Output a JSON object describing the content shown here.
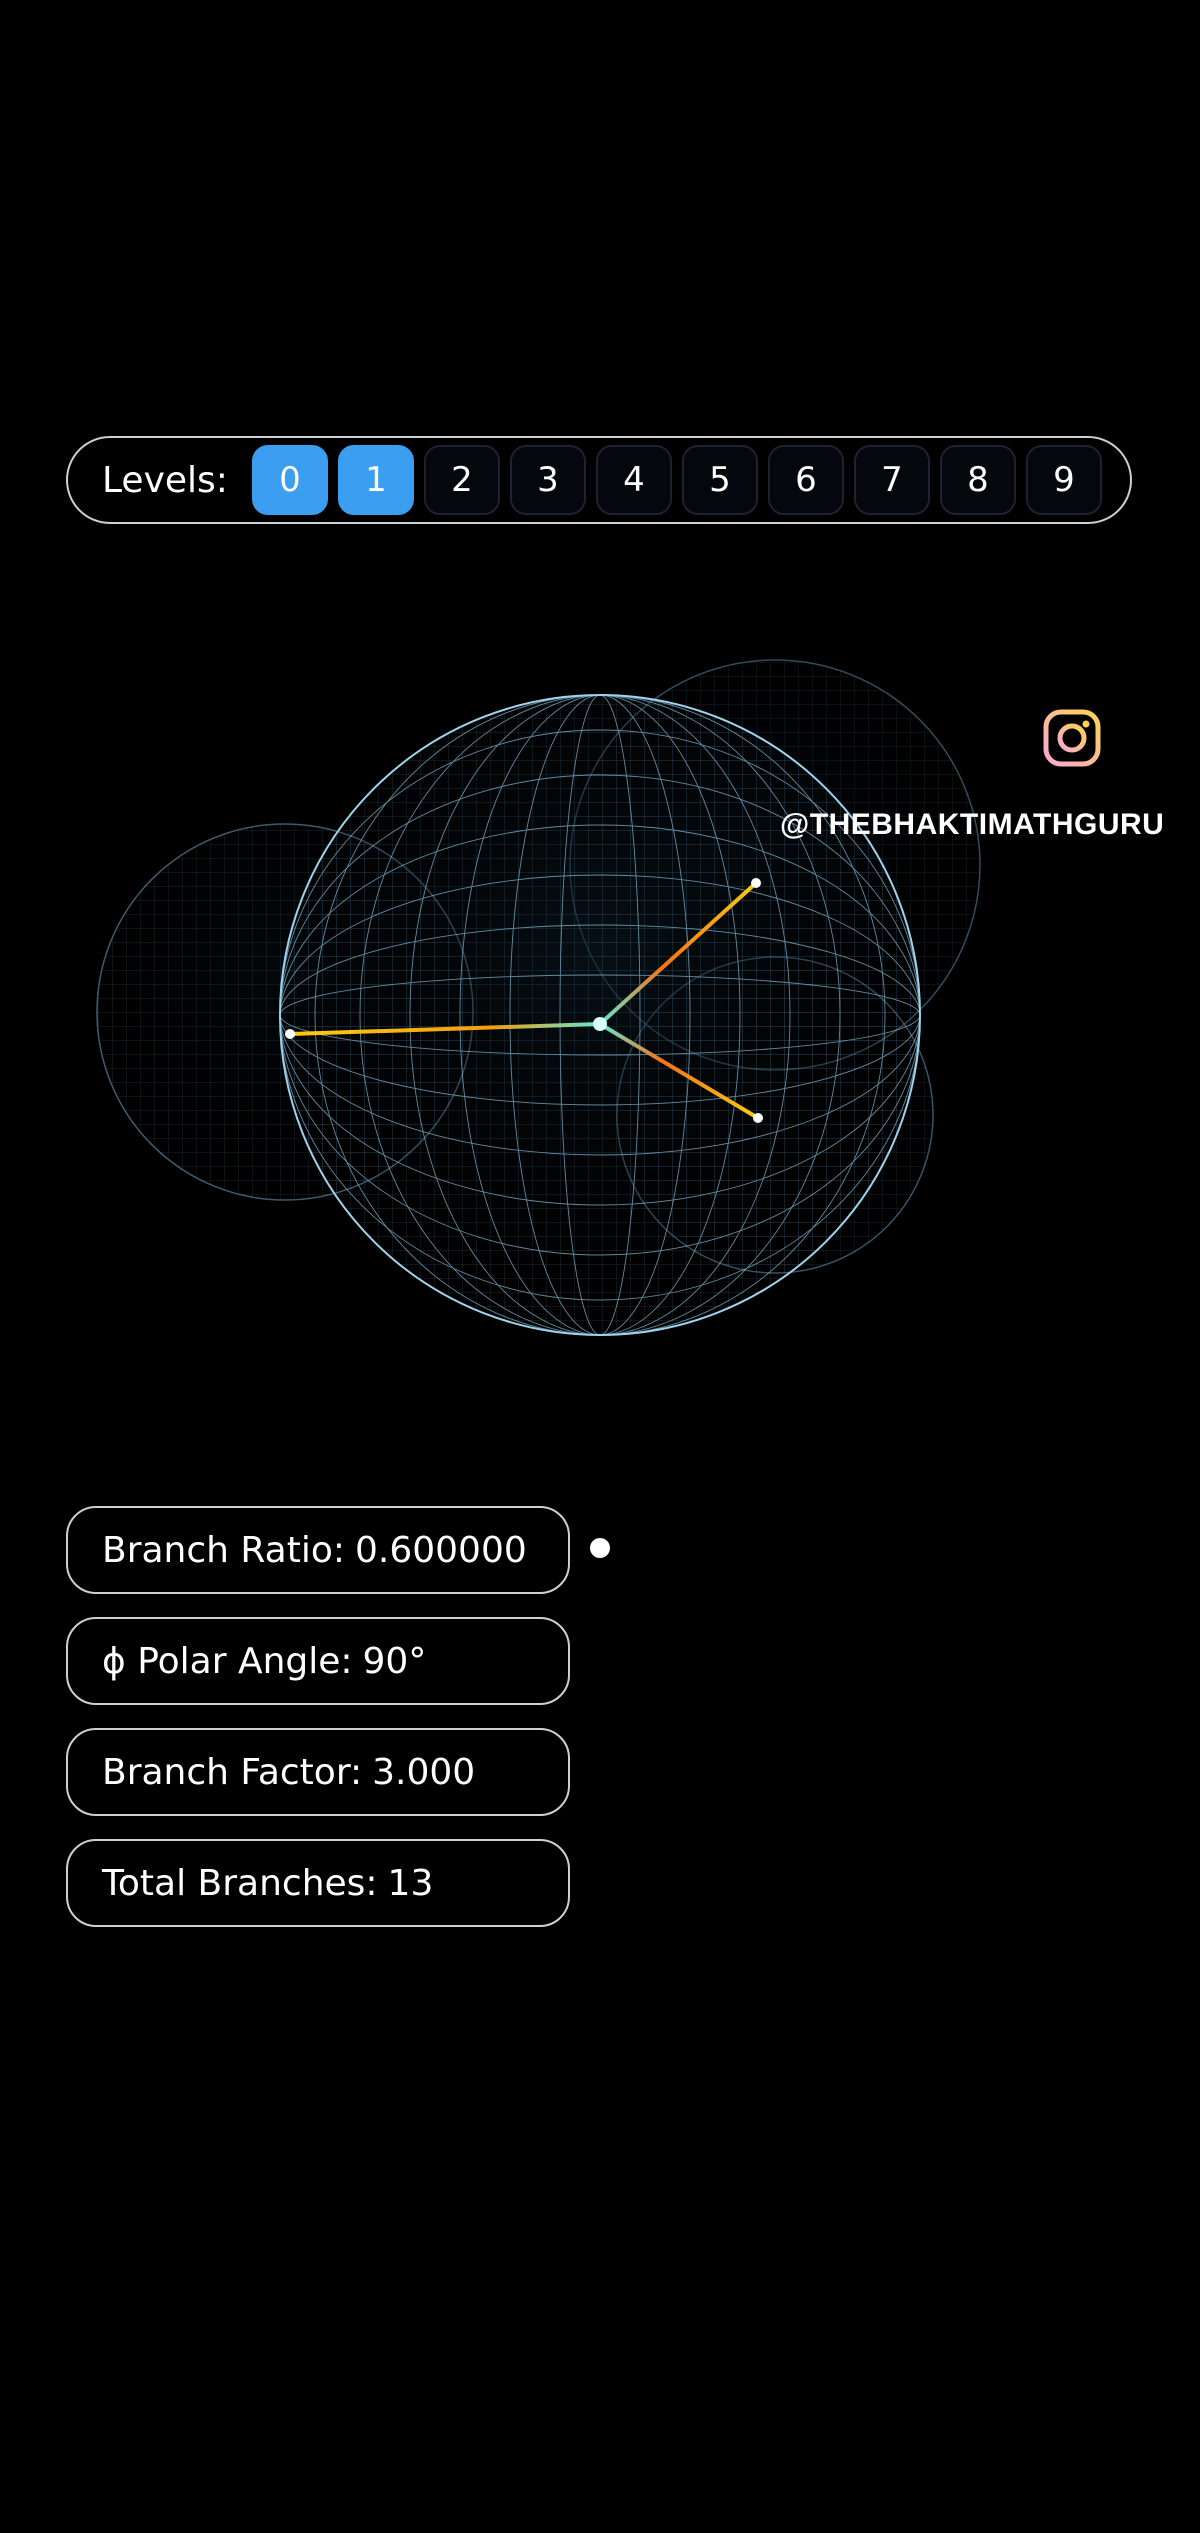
{
  "levels": {
    "label": "Levels:",
    "options": [
      "0",
      "1",
      "2",
      "3",
      "4",
      "5",
      "6",
      "7",
      "8",
      "9"
    ],
    "active": [
      "0",
      "1"
    ],
    "active_color": "#3b9ef0"
  },
  "watermark": {
    "icon": "instagram-icon",
    "handle": "@THEBHAKTIMATHGURU"
  },
  "info": {
    "branch_ratio_label": "Branch Ratio:",
    "branch_ratio_value": "0.600000",
    "polar_angle_label": "ϕ Polar Angle:",
    "polar_angle_value": "90°",
    "branch_factor_label": "Branch Factor:",
    "branch_factor_value": "3.000",
    "total_branches_label": "Total Branches:",
    "total_branches_value": "13"
  },
  "colors": {
    "sphere_wire": "#7fb8d8",
    "trunk": "#a78bfa",
    "branch_teal": "#5eead4",
    "branch_orange": "#f59e0b",
    "branch_yellow": "#facc15"
  }
}
